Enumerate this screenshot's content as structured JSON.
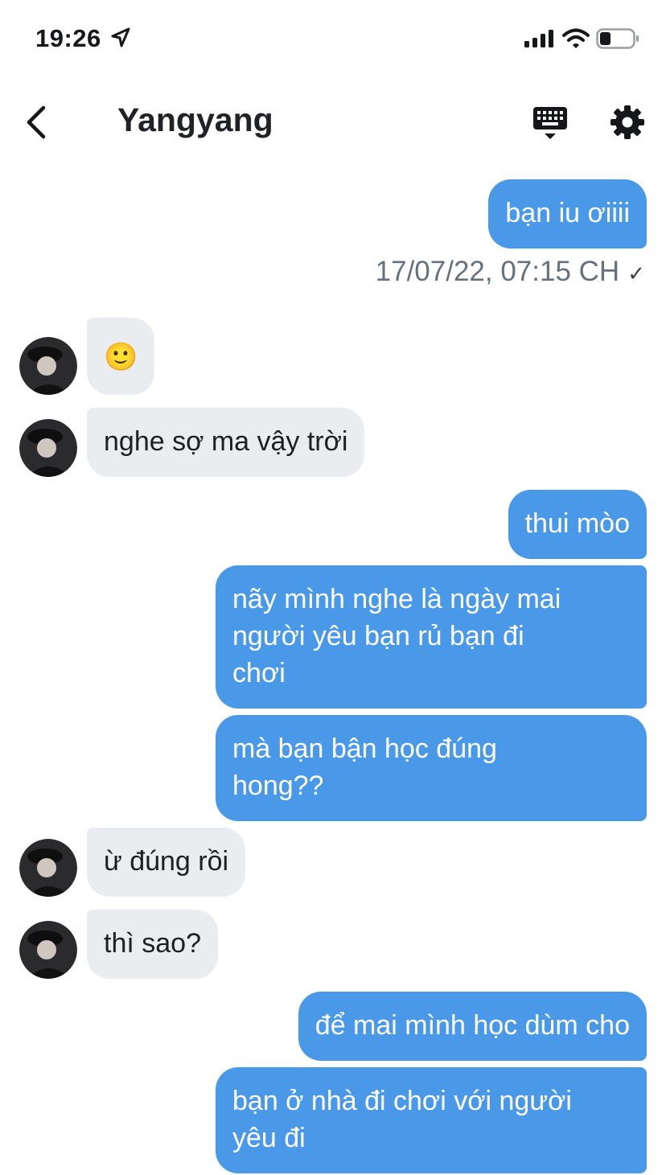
{
  "status_bar": {
    "time": "19:26",
    "location_icon": "location-arrow-icon",
    "signal_icon": "cellular-signal-icon",
    "wifi_icon": "wifi-icon",
    "battery_icon": "battery-icon"
  },
  "header": {
    "title": "Yangyang",
    "back_icon": "chevron-left-icon",
    "keyboard_icon": "keyboard-icon",
    "settings_icon": "gear-icon"
  },
  "colors": {
    "outgoing_bubble": "#4a99e9",
    "incoming_bubble": "#e9edf0",
    "timestamp": "#66717c"
  },
  "messages": [
    {
      "dir": "out",
      "text": "bạn iu ơiiii"
    },
    {
      "dir": "meta",
      "text": "17/07/22, 07:15 CH",
      "check": "✓"
    },
    {
      "dir": "in",
      "text": "🙂"
    },
    {
      "dir": "in",
      "text": "nghe sợ ma vậy trời"
    },
    {
      "dir": "out",
      "text": "thui mòo"
    },
    {
      "dir": "out",
      "lines": [
        "nãy mình nghe là ngày mai",
        "người yêu bạn rủ bạn đi",
        "chơi"
      ]
    },
    {
      "dir": "out",
      "lines": [
        "mà bạn bận học đúng",
        "hong??"
      ]
    },
    {
      "dir": "in",
      "text": "ừ đúng rồi"
    },
    {
      "dir": "in",
      "text": "thì sao?"
    },
    {
      "dir": "out",
      "text": "để mai mình học dùm cho"
    },
    {
      "dir": "out",
      "lines": [
        "bạn ở nhà đi chơi với người",
        "yêu đi"
      ]
    }
  ]
}
